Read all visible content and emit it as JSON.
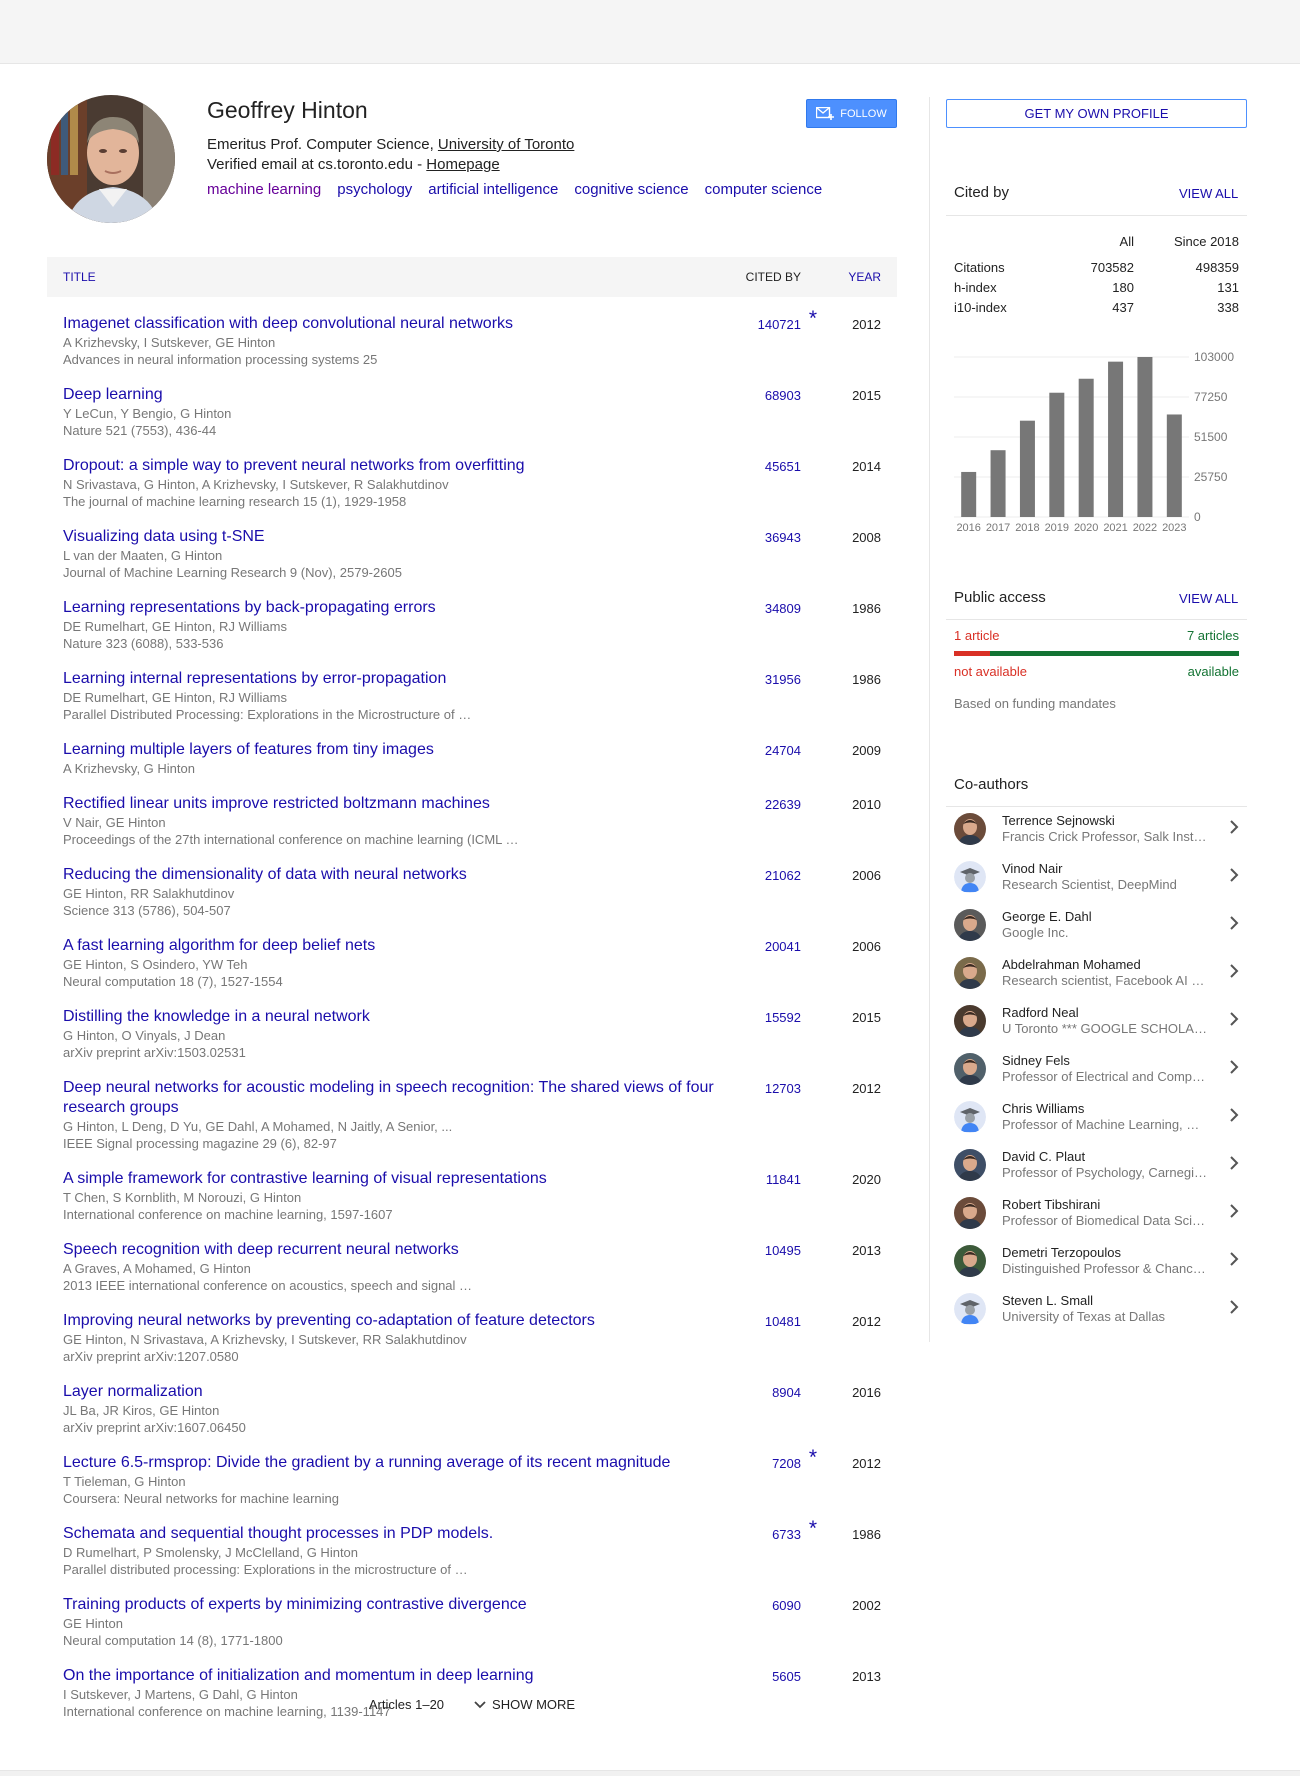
{
  "profile": {
    "name": "Geoffrey Hinton",
    "affiliation_prefix": "Emeritus Prof. Computer Science, ",
    "affiliation_link": "University of Toronto",
    "email_prefix": "Verified email at cs.toronto.edu - ",
    "homepage_link": "Homepage",
    "interests": [
      "machine learning",
      "psychology",
      "artificial intelligence",
      "cognitive science",
      "computer science"
    ],
    "follow_label": "FOLLOW"
  },
  "table": {
    "col_title": "TITLE",
    "col_cited": "CITED BY",
    "col_year": "YEAR"
  },
  "articles": [
    {
      "title": "Imagenet classification with deep convolutional neural networks",
      "authors": "A Krizhevsky, I Sutskever, GE Hinton",
      "venue": "Advances in neural information processing systems 25",
      "cited": "140721",
      "star": "*",
      "year": "2012"
    },
    {
      "title": "Deep learning",
      "authors": "Y LeCun, Y Bengio, G Hinton",
      "venue": "Nature 521 (7553), 436-44",
      "cited": "68903",
      "star": "",
      "year": "2015"
    },
    {
      "title": "Dropout: a simple way to prevent neural networks from overfitting",
      "authors": "N Srivastava, G Hinton, A Krizhevsky, I Sutskever, R Salakhutdinov",
      "venue": "The journal of machine learning research 15 (1), 1929-1958",
      "cited": "45651",
      "star": "",
      "year": "2014"
    },
    {
      "title": "Visualizing data using t-SNE",
      "authors": "L van der Maaten, G Hinton",
      "venue": "Journal of Machine Learning Research 9 (Nov), 2579-2605",
      "cited": "36943",
      "star": "",
      "year": "2008"
    },
    {
      "title": "Learning representations by back-propagating errors",
      "authors": "DE Rumelhart, GE Hinton, RJ Williams",
      "venue": "Nature 323 (6088), 533-536",
      "cited": "34809",
      "star": "",
      "year": "1986"
    },
    {
      "title": "Learning internal representations by error-propagation",
      "authors": "DE Rumelhart, GE Hinton, RJ Williams",
      "venue": "Parallel Distributed Processing: Explorations in the Microstructure of …",
      "cited": "31956",
      "star": "",
      "year": "1986"
    },
    {
      "title": "Learning multiple layers of features from tiny images",
      "authors": "A Krizhevsky, G Hinton",
      "venue": "",
      "cited": "24704",
      "star": "",
      "year": "2009"
    },
    {
      "title": "Rectified linear units improve restricted boltzmann machines",
      "authors": "V Nair, GE Hinton",
      "venue": "Proceedings of the 27th international conference on machine learning (ICML …",
      "cited": "22639",
      "star": "",
      "year": "2010"
    },
    {
      "title": "Reducing the dimensionality of data with neural networks",
      "authors": "GE Hinton, RR Salakhutdinov",
      "venue": "Science 313 (5786), 504-507",
      "cited": "21062",
      "star": "",
      "year": "2006"
    },
    {
      "title": "A fast learning algorithm for deep belief nets",
      "authors": "GE Hinton, S Osindero, YW Teh",
      "venue": "Neural computation 18 (7), 1527-1554",
      "cited": "20041",
      "star": "",
      "year": "2006"
    },
    {
      "title": "Distilling the knowledge in a neural network",
      "authors": "G Hinton, O Vinyals, J Dean",
      "venue": "arXiv preprint arXiv:1503.02531",
      "cited": "15592",
      "star": "",
      "year": "2015"
    },
    {
      "title": "Deep neural networks for acoustic modeling in speech recognition: The shared views of four research groups",
      "authors": "G Hinton, L Deng, D Yu, GE Dahl, A Mohamed, N Jaitly, A Senior, ...",
      "venue": "IEEE Signal processing magazine 29 (6), 82-97",
      "cited": "12703",
      "star": "",
      "year": "2012"
    },
    {
      "title": "A simple framework for contrastive learning of visual representations",
      "authors": "T Chen, S Kornblith, M Norouzi, G Hinton",
      "venue": "International conference on machine learning, 1597-1607",
      "cited": "11841",
      "star": "",
      "year": "2020"
    },
    {
      "title": "Speech recognition with deep recurrent neural networks",
      "authors": "A Graves, A Mohamed, G Hinton",
      "venue": "2013 IEEE international conference on acoustics, speech and signal …",
      "cited": "10495",
      "star": "",
      "year": "2013"
    },
    {
      "title": "Improving neural networks by preventing co-adaptation of feature detectors",
      "authors": "GE Hinton, N Srivastava, A Krizhevsky, I Sutskever, RR Salakhutdinov",
      "venue": "arXiv preprint arXiv:1207.0580",
      "cited": "10481",
      "star": "",
      "year": "2012"
    },
    {
      "title": "Layer normalization",
      "authors": "JL Ba, JR Kiros, GE Hinton",
      "venue": "arXiv preprint arXiv:1607.06450",
      "cited": "8904",
      "star": "",
      "year": "2016"
    },
    {
      "title": "Lecture 6.5-rmsprop: Divide the gradient by a running average of its recent magnitude",
      "authors": "T Tieleman, G Hinton",
      "venue": "Coursera: Neural networks for machine learning",
      "cited": "7208",
      "star": "*",
      "year": "2012"
    },
    {
      "title": "Schemata and sequential thought processes in PDP models.",
      "authors": "D Rumelhart, P Smolensky, J McClelland, G Hinton",
      "venue": "Parallel distributed processing: Explorations in the microstructure of …",
      "cited": "6733",
      "star": "*",
      "year": "1986"
    },
    {
      "title": "Training products of experts by minimizing contrastive divergence",
      "authors": "GE Hinton",
      "venue": "Neural computation 14 (8), 1771-1800",
      "cited": "6090",
      "star": "",
      "year": "2002"
    },
    {
      "title": "On the importance of initialization and momentum in deep learning",
      "authors": "I Sutskever, J Martens, G Dahl, G Hinton",
      "venue": "International conference on machine learning, 1139-1147",
      "cited": "5605",
      "star": "",
      "year": "2013"
    }
  ],
  "pagination": {
    "range": "Articles 1–20",
    "show_more": "SHOW MORE"
  },
  "sidebar": {
    "own_profile_label": "GET MY OWN PROFILE",
    "cited_by": {
      "heading": "Cited by",
      "view_all": "VIEW ALL",
      "col_all": "All",
      "col_since": "Since 2018",
      "rows": [
        {
          "label": "Citations",
          "all": "703582",
          "since": "498359"
        },
        {
          "label": "h-index",
          "all": "180",
          "since": "131"
        },
        {
          "label": "i10-index",
          "all": "437",
          "since": "338"
        }
      ]
    },
    "public_access": {
      "heading": "Public access",
      "view_all": "VIEW ALL",
      "na_count": "1 article",
      "av_count": "7 articles",
      "na_label": "not available",
      "av_label": "available",
      "note": "Based on funding mandates",
      "na_color": "#d93025",
      "av_color": "#137333",
      "na_fraction": 0.125
    },
    "coauthors_heading": "Co-authors",
    "coauthors": [
      {
        "name": "Terrence Sejnowski",
        "affil": "Francis Crick Professor, Salk Institute for Biological Studies",
        "photo": "photo"
      },
      {
        "name": "Vinod Nair",
        "affil": "Research Scientist, DeepMind",
        "photo": "placeholder"
      },
      {
        "name": "George E. Dahl",
        "affil": "Google Inc.",
        "photo": "photo"
      },
      {
        "name": "Abdelrahman Mohamed",
        "affil": "Research scientist, Facebook AI Research",
        "photo": "photo"
      },
      {
        "name": "Radford Neal",
        "affil": "U Toronto *** GOOGLE SCHOLAR IS NOT RELIABLE",
        "photo": "photo"
      },
      {
        "name": "Sidney Fels",
        "affil": "Professor of Electrical and Computer Engineering",
        "photo": "photo"
      },
      {
        "name": "Chris Williams",
        "affil": "Professor of Machine Learning, University of Edinburgh",
        "photo": "placeholder"
      },
      {
        "name": "David C. Plaut",
        "affil": "Professor of Psychology, Carnegie Mellon University",
        "photo": "photo"
      },
      {
        "name": "Robert Tibshirani",
        "affil": "Professor of Biomedical Data Science and Statistics",
        "photo": "photo"
      },
      {
        "name": "Demetri Terzopoulos",
        "affil": "Distinguished Professor & Chancellor's Professor",
        "photo": "photo"
      },
      {
        "name": "Steven L. Small",
        "affil": "University of Texas at Dallas",
        "photo": "placeholder"
      }
    ]
  },
  "chart_data": {
    "type": "bar",
    "categories": [
      "2016",
      "2017",
      "2018",
      "2019",
      "2020",
      "2021",
      "2022",
      "2023"
    ],
    "values": [
      29000,
      43000,
      62000,
      80000,
      89000,
      100000,
      103000,
      66000
    ],
    "yticks": [
      "103000",
      "77250",
      "51500",
      "25750",
      "0"
    ],
    "ylim": [
      0,
      103000
    ],
    "grid": true,
    "bar_color": "#777777"
  }
}
